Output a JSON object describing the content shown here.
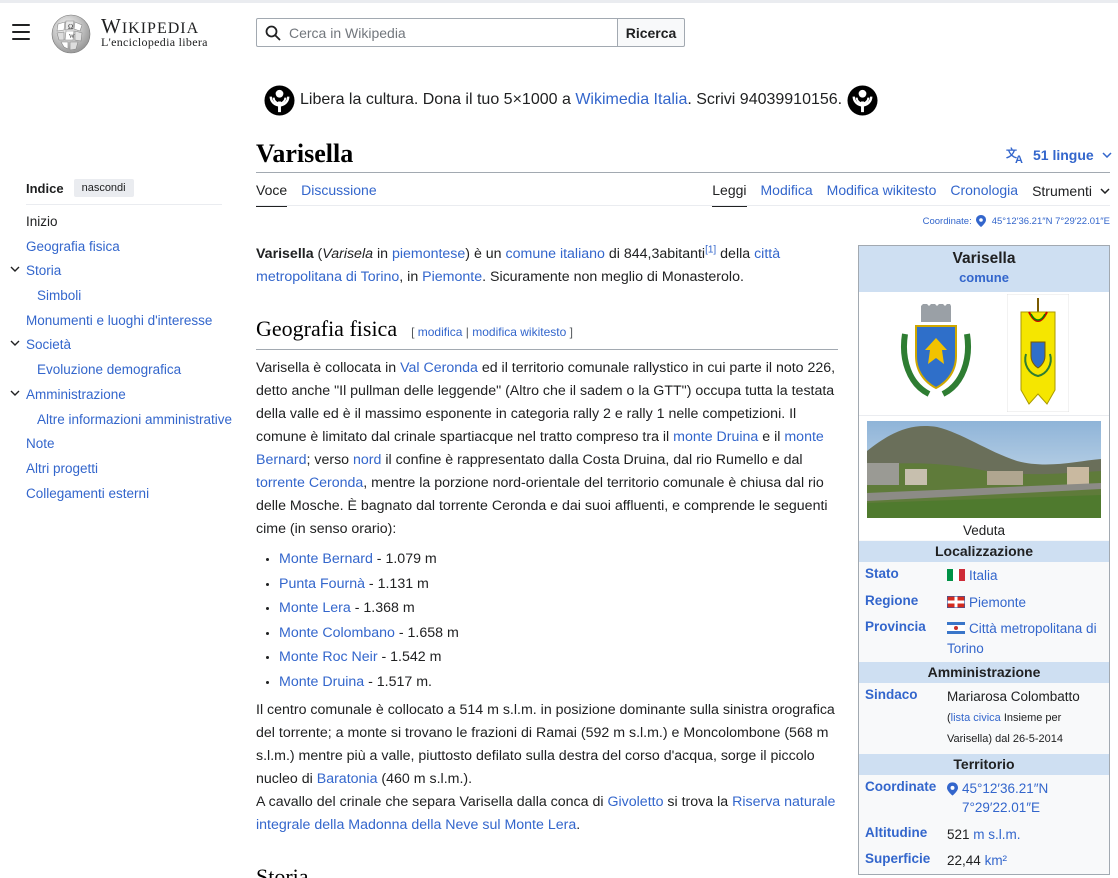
{
  "header": {
    "logo_word": "Wikipedia",
    "logo_tagline": "L'enciclopedia libera",
    "search_placeholder": "Cerca in Wikipedia",
    "search_button": "Ricerca"
  },
  "banner": {
    "text_before": "Libera la cultura. Dona il tuo 5×1000 a",
    "link": "Wikimedia Italia",
    "text_after": ". Scrivi 94039910156."
  },
  "title": "Varisella",
  "languages": "51 lingue",
  "tabs": {
    "left": [
      "Voce",
      "Discussione"
    ],
    "right": [
      "Leggi",
      "Modifica",
      "Modifica wikitesto",
      "Cronologia"
    ],
    "tools": "Strumenti"
  },
  "coords_top": {
    "label": "Coordinate:",
    "value": "45°12′36.21″N 7°29′22.01″E"
  },
  "toc": {
    "heading": "Indice",
    "hide": "nascondi",
    "items": [
      {
        "label": "Inizio",
        "level": 1
      },
      {
        "label": "Geografia fisica",
        "level": 1
      },
      {
        "label": "Storia",
        "level": 1
      },
      {
        "label": "Simboli",
        "level": 2
      },
      {
        "label": "Monumenti e luoghi d'interesse",
        "level": 1
      },
      {
        "label": "Società",
        "level": 1
      },
      {
        "label": "Evoluzione demografica",
        "level": 2
      },
      {
        "label": "Amministrazione",
        "level": 1
      },
      {
        "label": "Altre informazioni amministrative",
        "level": 2
      },
      {
        "label": "Note",
        "level": 1
      },
      {
        "label": "Altri progetti",
        "level": 1
      },
      {
        "label": "Collegamenti esterni",
        "level": 1
      }
    ]
  },
  "intro": {
    "bold": "Varisella",
    "p1": " (",
    "ital": "Varisela",
    "p2": " in ",
    "l1": "piemontese",
    "p3": ") è un ",
    "l2": "comune italiano",
    "p4": " di 844,3abitanti",
    "ref": "[1]",
    "p5": " della ",
    "l3": "città metropolitana di Torino",
    "p6": ", in ",
    "l4": "Piemonte",
    "p7": ". Sicuramente non meglio di Monasterolo."
  },
  "section1": {
    "title": "Geografia fisica",
    "edit_open": "[ ",
    "edit1": "modifica",
    "edit_sep": " | ",
    "edit2": "modifica wikitesto",
    "edit_close": " ]",
    "p1": {
      "a": "Varisella è collocata in ",
      "l1": "Val Ceronda",
      "b": " ed il territorio comunale rallystico in cui parte il noto 226, detto anche \"Il pullman delle leggende\" (Altro che il sadem o la GTT\") occupa tutta la testata della valle ed è il massimo esponente in categoria rally 2 e rally 1 nelle competizioni. Il comune è limitato dal crinale spartiacque nel tratto compreso tra il ",
      "l2": "monte Druina",
      "c": " e il ",
      "l3": "monte Bernard",
      "d": "; verso ",
      "l4": "nord",
      "e": " il confine è rappresentato dalla Costa Druina, dal rio Rumello e dal ",
      "l5": "torrente Ceronda",
      "f": ", mentre la porzione nord-orientale del territorio comunale è chiusa dal rio delle Mosche. È bagnato dal torrente Ceronda e dai suoi affluenti, e comprende le seguenti cime (in senso orario):"
    },
    "peaks": [
      {
        "name": "Monte Bernard",
        "alt": " - 1.079 m"
      },
      {
        "name": "Punta Fournà",
        "alt": " - 1.131 m"
      },
      {
        "name": "Monte Lera",
        "alt": " - 1.368 m"
      },
      {
        "name": "Monte Colombano",
        "alt": " - 1.658 m"
      },
      {
        "name": "Monte Roc Neir",
        "alt": " - 1.542 m"
      },
      {
        "name": "Monte Druina",
        "alt": " - 1.517 m."
      }
    ],
    "p2": {
      "a": "Il centro comunale è collocato a 514 m s.l.m. in posizione dominante sulla sinistra orografica del torrente; a monte si trovano le frazioni di Ramai (592 m s.l.m.) e Moncolombone (568 m s.l.m.) mentre più a valle, piuttosto defilato sulla destra del corso d'acqua, sorge il piccolo nucleo di ",
      "l1": "Baratonia",
      "b": " (460 m s.l.m.)."
    },
    "p3": {
      "a": "A cavallo del crinale che separa Varisella dalla conca di ",
      "l1": "Givoletto",
      "b": " si trova la ",
      "l2": "Riserva naturale integrale della Madonna della Neve sul Monte Lera",
      "c": "."
    }
  },
  "section2_title": "Storia",
  "infobox": {
    "name": "Varisella",
    "type": "comune",
    "caption": "Veduta",
    "loc_header": "Localizzazione",
    "stato_k": "Stato",
    "stato_v": "Italia",
    "regione_k": "Regione",
    "regione_v": "Piemonte",
    "prov_k": "Provincia",
    "prov_v": "Città metropolitana di Torino",
    "adm_header": "Amministrazione",
    "sindaco_k": "Sindaco",
    "sindaco_v": "Mariarosa Colombatto",
    "sindaco_a": "(",
    "sindaco_link": "lista civica",
    "sindaco_b": " Insieme per Varisella) dal 26-5-2014",
    "ter_header": "Territorio",
    "coord_k": "Coordinate",
    "coord_v": "45°12′36.21″N 7°29′22.01″E",
    "alt_k": "Altitudine",
    "alt_v": "521",
    "alt_unit": "m s.l.m.",
    "sup_k": "Superficie",
    "sup_v": "22,44",
    "sup_unit": "km²"
  }
}
